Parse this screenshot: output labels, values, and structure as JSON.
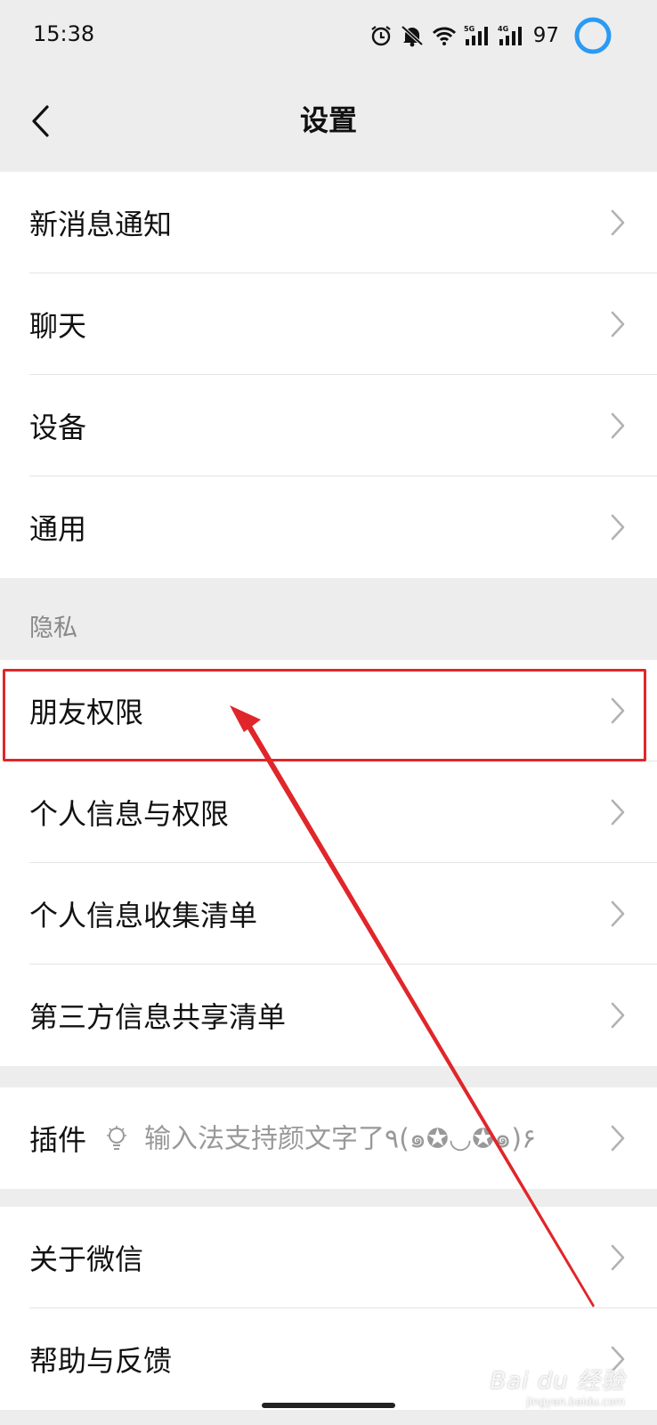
{
  "status_bar": {
    "time": "15:38",
    "battery": "97",
    "icons": [
      "alarm-icon",
      "mute-icon",
      "wifi-icon",
      "signal-5g-icon",
      "signal-4g-icon",
      "battery-ring-icon"
    ],
    "network_labels": [
      "5G",
      "4G"
    ]
  },
  "nav": {
    "title": "设置"
  },
  "groups": {
    "main": [
      "新消息通知",
      "聊天",
      "设备",
      "通用"
    ],
    "privacy_header": "隐私",
    "privacy": [
      "朋友权限",
      "个人信息与权限",
      "个人信息收集清单",
      "第三方信息共享清单"
    ],
    "plugin": {
      "label": "插件",
      "description": "输入法支持颜文字了٩(๑✪◡✪๑)۶"
    },
    "about": [
      "关于微信",
      "帮助与反馈"
    ]
  },
  "watermark": {
    "text": "Bai du 经验",
    "sub": "jingyan.baidu.com"
  },
  "colors": {
    "background": "#ededed",
    "highlight": "#e0262a",
    "battery_ring": "#2b9af3"
  }
}
